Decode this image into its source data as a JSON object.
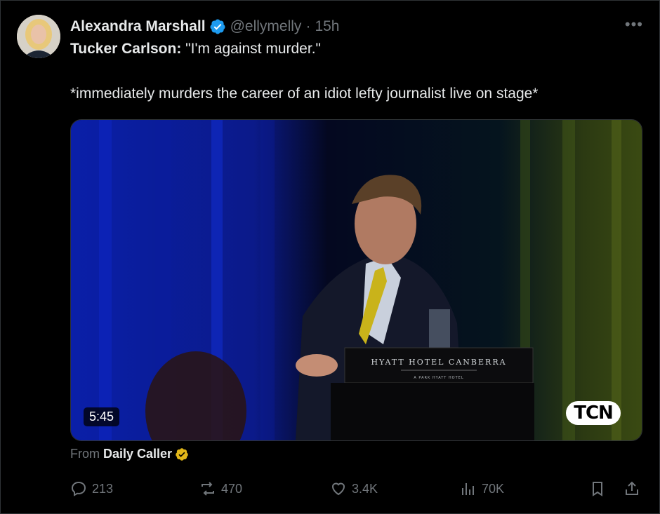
{
  "post": {
    "display_name": "Alexandra Marshall",
    "handle": "@ellymelly",
    "separator": "·",
    "time": "15h",
    "more_icon": "more-horizontal-icon",
    "quote_speaker": "Tucker Carlson:",
    "quote_text": " \"I'm against murder.\"",
    "line2": "*immediately murders the career of an idiot lefty journalist live on stage*"
  },
  "media": {
    "duration": "5:45",
    "watermark": "TCN",
    "podium_text": "HYATT HOTEL CANBERRA",
    "podium_subtext": "A PARK HYATT HOTEL"
  },
  "source": {
    "prefix": "From",
    "name": "Daily Caller"
  },
  "actions": {
    "replies": "213",
    "reposts": "470",
    "likes": "3.4K",
    "views": "70K"
  },
  "colors": {
    "background": "#000000",
    "text": "#e7e9ea",
    "muted": "#71767b",
    "verified_blue": "#1d9bf0",
    "verified_gold": "#e2b719"
  }
}
